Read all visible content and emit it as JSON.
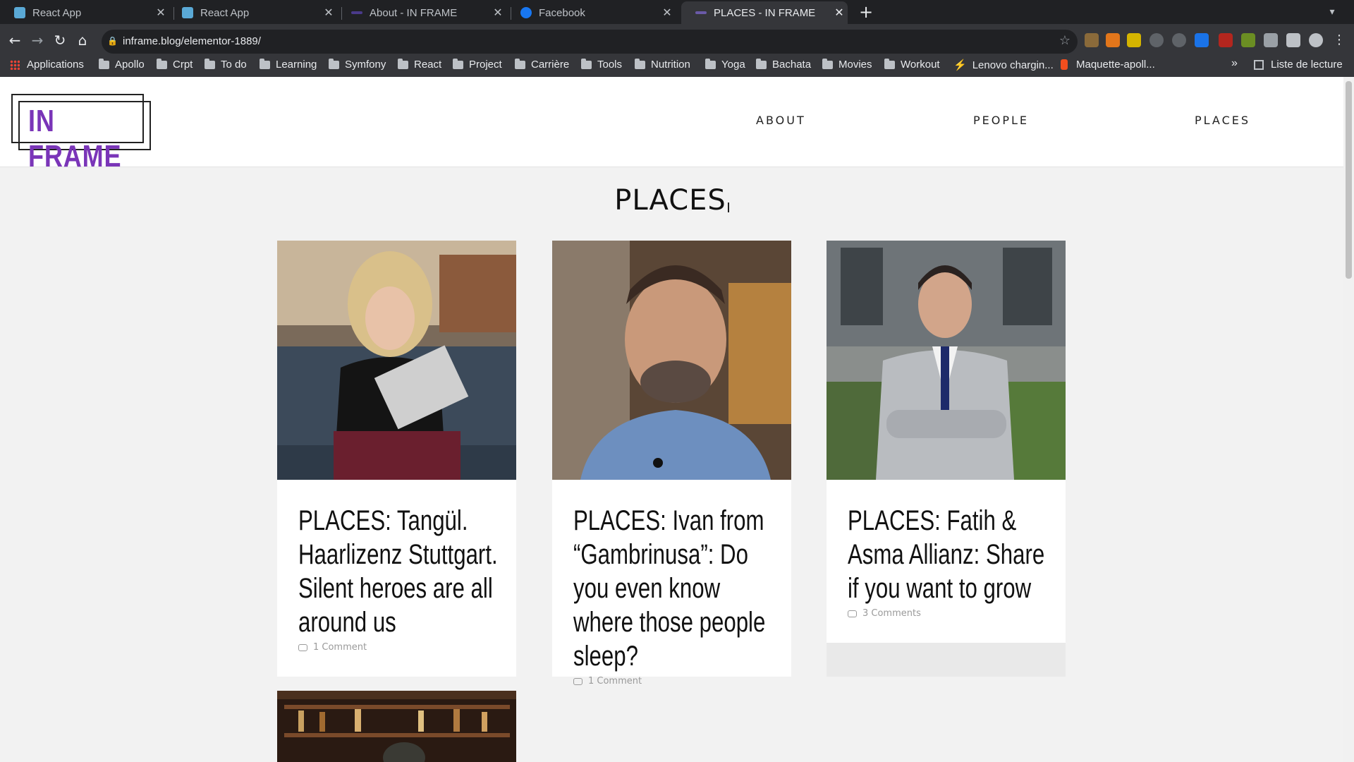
{
  "browser": {
    "tabs": [
      {
        "title": "React App",
        "active": false,
        "favicon": "react-icon"
      },
      {
        "title": "React App",
        "active": false,
        "favicon": "react-icon"
      },
      {
        "title": "About - IN FRAME",
        "active": false,
        "favicon": "inframe-icon"
      },
      {
        "title": "Facebook",
        "active": false,
        "favicon": "facebook-icon"
      },
      {
        "title": "PLACES - IN FRAME",
        "active": true,
        "favicon": "inframe-icon"
      }
    ],
    "url": "inframe.blog/elementor-1889/",
    "bookmarks": [
      {
        "label": "Applications",
        "icon": "apps-grid-icon"
      },
      {
        "label": "Apollo",
        "icon": "folder-icon"
      },
      {
        "label": "Crpt",
        "icon": "folder-icon"
      },
      {
        "label": "To do",
        "icon": "folder-icon"
      },
      {
        "label": "Learning",
        "icon": "folder-icon"
      },
      {
        "label": "Symfony",
        "icon": "folder-icon"
      },
      {
        "label": "React",
        "icon": "folder-icon"
      },
      {
        "label": "Project",
        "icon": "folder-icon"
      },
      {
        "label": "Carrière",
        "icon": "folder-icon"
      },
      {
        "label": "Tools",
        "icon": "folder-icon"
      },
      {
        "label": "Nutrition",
        "icon": "folder-icon"
      },
      {
        "label": "Yoga",
        "icon": "folder-icon"
      },
      {
        "label": "Bachata",
        "icon": "folder-icon"
      },
      {
        "label": "Movies",
        "icon": "folder-icon"
      },
      {
        "label": "Workout",
        "icon": "folder-icon"
      },
      {
        "label": "Lenovo chargin...",
        "icon": "lightning-icon"
      },
      {
        "label": "Maquette-apoll...",
        "icon": "figma-icon"
      }
    ],
    "reading_list": "Liste de lecture",
    "more": "»"
  },
  "site": {
    "logo": "IN FRAME",
    "menu": [
      "ABOUT",
      "PEOPLE",
      "PLACES"
    ],
    "page_title": "PLACES",
    "posts": [
      {
        "title": "PLACES: Tangül. Haarlizenz Stuttgart. Silent heroes are all around us",
        "comments": "1 Comment"
      },
      {
        "title": "PLACES: Ivan from “Gambrinusa”: Do you even know where those people sleep?",
        "comments": "1 Comment"
      },
      {
        "title": "PLACES: Fatih & Asma Allianz: Share if you want to grow",
        "comments": "3 Comments"
      }
    ]
  },
  "colors": {
    "logo_purple": "#7a35b8",
    "chrome_dark": "#202124",
    "chrome_toolbar": "#35363a"
  }
}
